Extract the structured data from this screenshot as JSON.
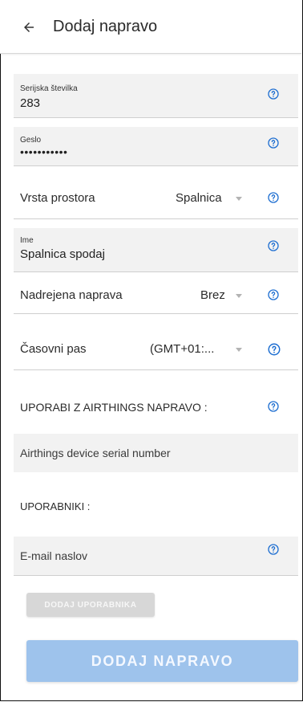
{
  "header": {
    "title": "Dodaj napravo"
  },
  "form": {
    "serial": {
      "label": "Serijska številka",
      "value": "283"
    },
    "password": {
      "label": "Geslo",
      "value": "•••••••••••"
    },
    "room_type": {
      "label": "Vrsta prostora",
      "value": "Spalnica"
    },
    "name": {
      "label": "Ime",
      "value": "Spalnica spodaj"
    },
    "parent_device": {
      "label": "Nadrejena naprava",
      "value": "Brez"
    },
    "timezone": {
      "label": "Časovni pas",
      "value": "(GMT+01:..."
    },
    "airthings": {
      "label": "UPORABI Z AIRTHINGS NAPRAVO :",
      "placeholder": "Airthings device serial number"
    },
    "users": {
      "label": "UPORABNIKI :",
      "email_placeholder": "E-mail naslov"
    }
  },
  "buttons": {
    "add_user": "DODAJ UPORABNIKA",
    "add_device": "DODAJ NAPRAVO"
  },
  "colors": {
    "help_icon": "#1f6fd1",
    "primary_disabled": "#9ec3ec",
    "secondary_disabled": "#d7d7d7"
  }
}
